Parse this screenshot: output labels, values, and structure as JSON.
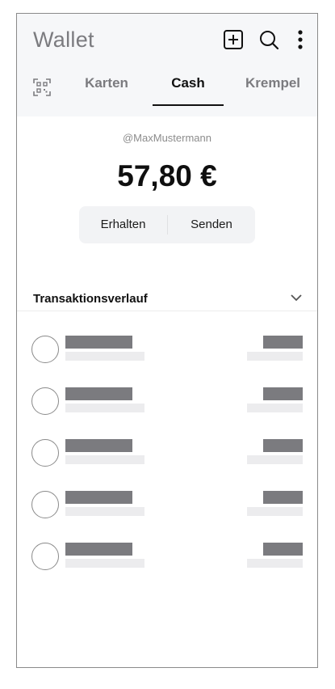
{
  "header": {
    "title": "Wallet",
    "icons": [
      "plus-square-icon",
      "search-icon",
      "more-vertical-icon"
    ]
  },
  "tabs": [
    {
      "label": "Karten",
      "active": false
    },
    {
      "label": "Cash",
      "active": true
    },
    {
      "label": "Krempel",
      "active": false
    }
  ],
  "qr_icon": "qr-code-icon",
  "account": {
    "username": "@MaxMustermann",
    "balance": "57,80 €"
  },
  "actions": {
    "receive_label": "Erhalten",
    "send_label": "Senden"
  },
  "transactions": {
    "title": "Transaktionsverlauf",
    "icon": "chevron-down-icon",
    "placeholder_rows": 5
  },
  "colors": {
    "header_bg": "#f6f7f9",
    "skeleton_dark": "#7b7b7f",
    "skeleton_light": "#ececee",
    "active_tab": "#111111",
    "inactive_tab": "#7b7b7f"
  }
}
